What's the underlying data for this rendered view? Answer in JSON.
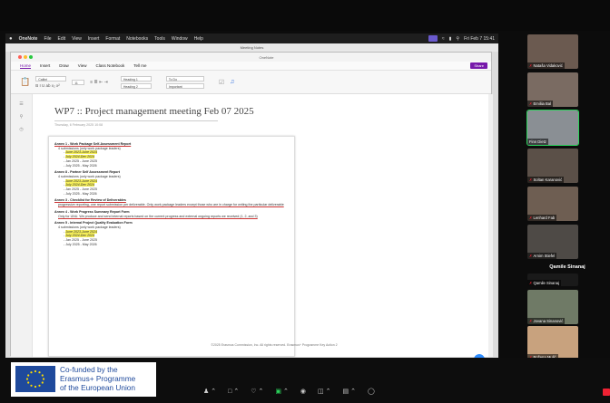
{
  "mac_menu": {
    "app": "OneNote",
    "items": [
      "File",
      "Edit",
      "View",
      "Insert",
      "Format",
      "Notebooks",
      "Tools",
      "Window",
      "Help"
    ],
    "clock": "Fri Feb 7 15:41"
  },
  "window": {
    "title": "Meeting Notes",
    "doc_label": "OneNote"
  },
  "ribbon": {
    "tabs": [
      "Home",
      "Insert",
      "Draw",
      "View",
      "Class Notebook",
      "Tell me"
    ],
    "active_tab": "Home",
    "share_label": "Share",
    "font_name": "Calibri",
    "font_size": "11",
    "style1": "Heading 1",
    "style2": "Heading 2",
    "tag1": "To Do",
    "tag2": "Important"
  },
  "page": {
    "title": "WP7 :: Project management meeting Feb 07 2025",
    "meta": "Thursday, 6 February 2025     10:08",
    "annexes": [
      {
        "heading": "Annex 1 - Work Package Self-Assessment Report",
        "sub": "4 submissions (only work package leaders)",
        "items": [
          "June 2023-June 2024",
          "July 2024-Dec 2024",
          "Jan 2025 - June 2025",
          "July 2025 - May 2026"
        ],
        "highlighted": [
          0,
          1
        ]
      },
      {
        "heading": "Annex 8 - Partner Self Assessment Report",
        "sub": "4 submissions (only work package leaders)",
        "items": [
          "June 2023-June 2024",
          "July 2024-Dec 2024",
          "Jan 2025 - June 2025",
          "July 2025 - May 2026"
        ],
        "highlighted": [
          0,
          1
        ]
      },
      {
        "heading": "Annex 3 - Checklist for Review of Deliverables",
        "sub": "progressive reporting, one report submission per deliverable. Only work package leaders except those who are in charge for writing the particular deliverable",
        "items": [],
        "highlighted": []
      },
      {
        "heading": "Annex 4 - Work Progress Summary Report Form",
        "sub": "Only for UNU. We produce and send internal reports based on the current progress and external ongoing reports we received (1, 2, and 3)",
        "items": [],
        "highlighted": []
      },
      {
        "heading": "Annex 5 - Internal Project Quality Evaluation Form",
        "sub": "4 submissions (only work package leaders)",
        "items": [
          "June 2023-June 2024",
          "July 2024-Dec 2024",
          "Jan 2025 - June 2025",
          "July 2025 - May 2026"
        ],
        "highlighted": [
          0,
          1
        ]
      }
    ],
    "footnote": "©2025 Erasmus Commission, Inc. All rights reserved. Erasmus+ Programme Key Action 2"
  },
  "participants": [
    {
      "name": "Nataša Vidaković",
      "muted": true
    },
    {
      "name": "Emiliia Bal",
      "muted": true
    },
    {
      "name": "Finn Dietz",
      "muted": false,
      "speaking": true
    },
    {
      "name": "Soltan Karanović",
      "muted": true
    },
    {
      "name": "Lenhard Fab",
      "muted": true
    },
    {
      "name": "Arnim Stiefel",
      "muted": true
    },
    {
      "name": "Qamile Sinanaj",
      "muted": true
    },
    {
      "name": "Jovana Sinanović",
      "muted": true
    },
    {
      "name": "Božena Mulić",
      "muted": true
    }
  ],
  "active_speaker": "Qamile Sinanaj",
  "eu_logo": {
    "line1": "Co-funded by the",
    "line2": "Erasmus+ Programme",
    "line3": "of the European Union"
  },
  "colors": {
    "onenote_purple": "#7719aa",
    "highlight": "#f5ee5a",
    "eu_blue": "#1f4a9c",
    "active_green": "#2bd35b"
  }
}
